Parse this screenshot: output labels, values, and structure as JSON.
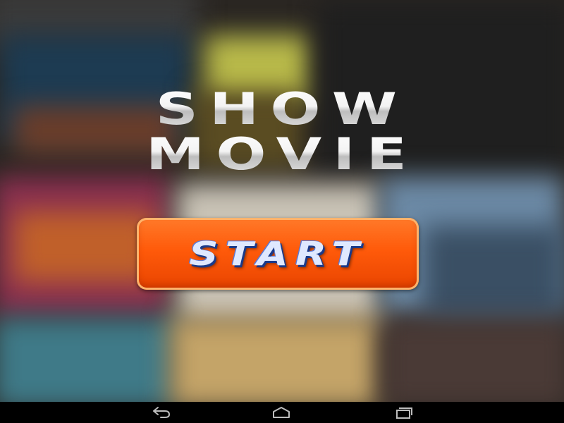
{
  "title": {
    "line1": "SHOW",
    "line2": "MOVIE"
  },
  "start_button": {
    "label": "START"
  },
  "navigation": {
    "back_icon": "back-arrow-icon",
    "home_icon": "home-icon",
    "recents_icon": "recents-icon"
  },
  "colors": {
    "button_orange": "#ff5a0a",
    "title_white": "#f2f2f2",
    "start_text_blue": "#dfe8ff",
    "nav_bar": "#000000"
  }
}
